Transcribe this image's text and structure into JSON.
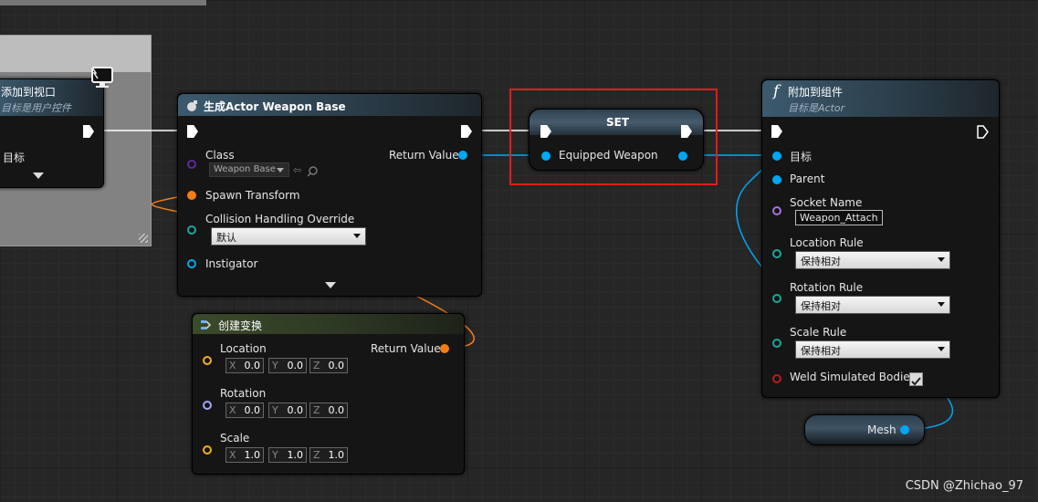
{
  "add_to_viewport_node": {
    "title": "添加到视口",
    "subtitle": "目标是用户控件",
    "target_label": "目标"
  },
  "spawn_actor_node": {
    "title": "生成Actor Weapon Base",
    "class_label": "Class",
    "class_value": "Weapon Base",
    "return_value_label": "Return Value",
    "spawn_transform_label": "Spawn Transform",
    "collision_label": "Collision Handling Override",
    "collision_value": "默认",
    "instigator_label": "Instigator"
  },
  "set_node": {
    "title": "SET",
    "var_label": "Equipped Weapon"
  },
  "attach_node": {
    "title": "附加到组件",
    "subtitle": "目标是Actor",
    "target_label": "目标",
    "parent_label": "Parent",
    "socket_label": "Socket Name",
    "socket_value": "Weapon_Attach",
    "location_rule_label": "Location Rule",
    "location_rule_value": "保持相对",
    "rotation_rule_label": "Rotation Rule",
    "rotation_rule_value": "保持相对",
    "scale_rule_label": "Scale Rule",
    "scale_rule_value": "保持相对",
    "weld_label": "Weld Simulated Bodies",
    "weld_checked": true
  },
  "make_transform_node": {
    "title": "创建变换",
    "location_label": "Location",
    "rotation_label": "Rotation",
    "scale_label": "Scale",
    "return_value_label": "Return Value",
    "axis_x": "X",
    "axis_y": "Y",
    "axis_z": "Z",
    "location": [
      "0.0",
      "0.0",
      "0.0"
    ],
    "rotation": [
      "0.0",
      "0.0",
      "0.0"
    ],
    "scale": [
      "1.0",
      "1.0",
      "1.0"
    ]
  },
  "mesh_node": {
    "label": "Mesh"
  },
  "watermark": "CSDN @Zhichao_97",
  "colors": {
    "exec": "#ffffff",
    "object_pin": "#00a8f3",
    "transform_pin": "#f57d16",
    "highlight": "#e21b1b",
    "background": "#262626"
  }
}
